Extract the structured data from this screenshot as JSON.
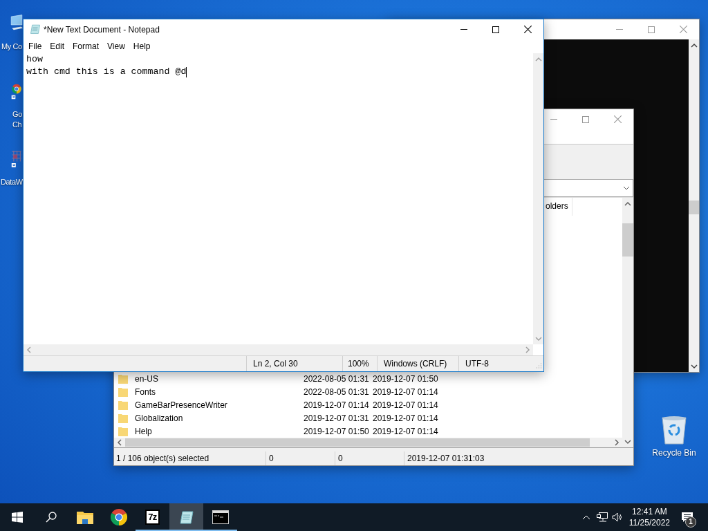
{
  "desktop": {
    "icons": [
      {
        "kind": "computer",
        "lines": [
          "My Co"
        ]
      },
      {
        "kind": "chrome",
        "lines": [
          "Go",
          "Ch"
        ]
      },
      {
        "kind": "app",
        "lines": [
          "DataW"
        ]
      }
    ],
    "recycle_bin": {
      "label": "Recycle Bin"
    }
  },
  "console_window": {
    "active": false
  },
  "file_manager": {
    "active": false,
    "column_header": "olders",
    "rows": [
      {
        "name": "en-US",
        "modified": "2022-08-05 01:31",
        "created": "2019-12-07 01:50"
      },
      {
        "name": "Fonts",
        "modified": "2022-08-05 01:31",
        "created": "2019-12-07 01:14"
      },
      {
        "name": "GameBarPresenceWriter",
        "modified": "2019-12-07 01:14",
        "created": "2019-12-07 01:14"
      },
      {
        "name": "Globalization",
        "modified": "2019-12-07 01:31",
        "created": "2019-12-07 01:14"
      },
      {
        "name": "Help",
        "modified": "2019-12-07 01:50",
        "created": "2019-12-07 01:14"
      }
    ],
    "status": [
      "1 / 106 object(s) selected",
      "0",
      "0",
      "2019-12-07 01:31:03"
    ]
  },
  "notepad": {
    "active": true,
    "title": "*New Text Document - Notepad",
    "menu": [
      "File",
      "Edit",
      "Format",
      "View",
      "Help"
    ],
    "lines": [
      "how",
      "with cmd this is a command @d"
    ],
    "status": [
      "Ln 2, Col 30",
      "100%",
      "Windows (CRLF)",
      "UTF-8"
    ]
  },
  "taskbar": {
    "apps": [
      {
        "kind": "explorer",
        "running": false,
        "active": false
      },
      {
        "kind": "chrome",
        "running": false,
        "active": false
      },
      {
        "kind": "archiver",
        "glyph": "7z",
        "running": true,
        "active": false
      },
      {
        "kind": "notepad",
        "running": true,
        "active": true
      },
      {
        "kind": "console",
        "running": true,
        "active": false
      }
    ],
    "clock": {
      "time": "12:41 AM",
      "date": "11/25/2022"
    },
    "notification_count": "1"
  }
}
